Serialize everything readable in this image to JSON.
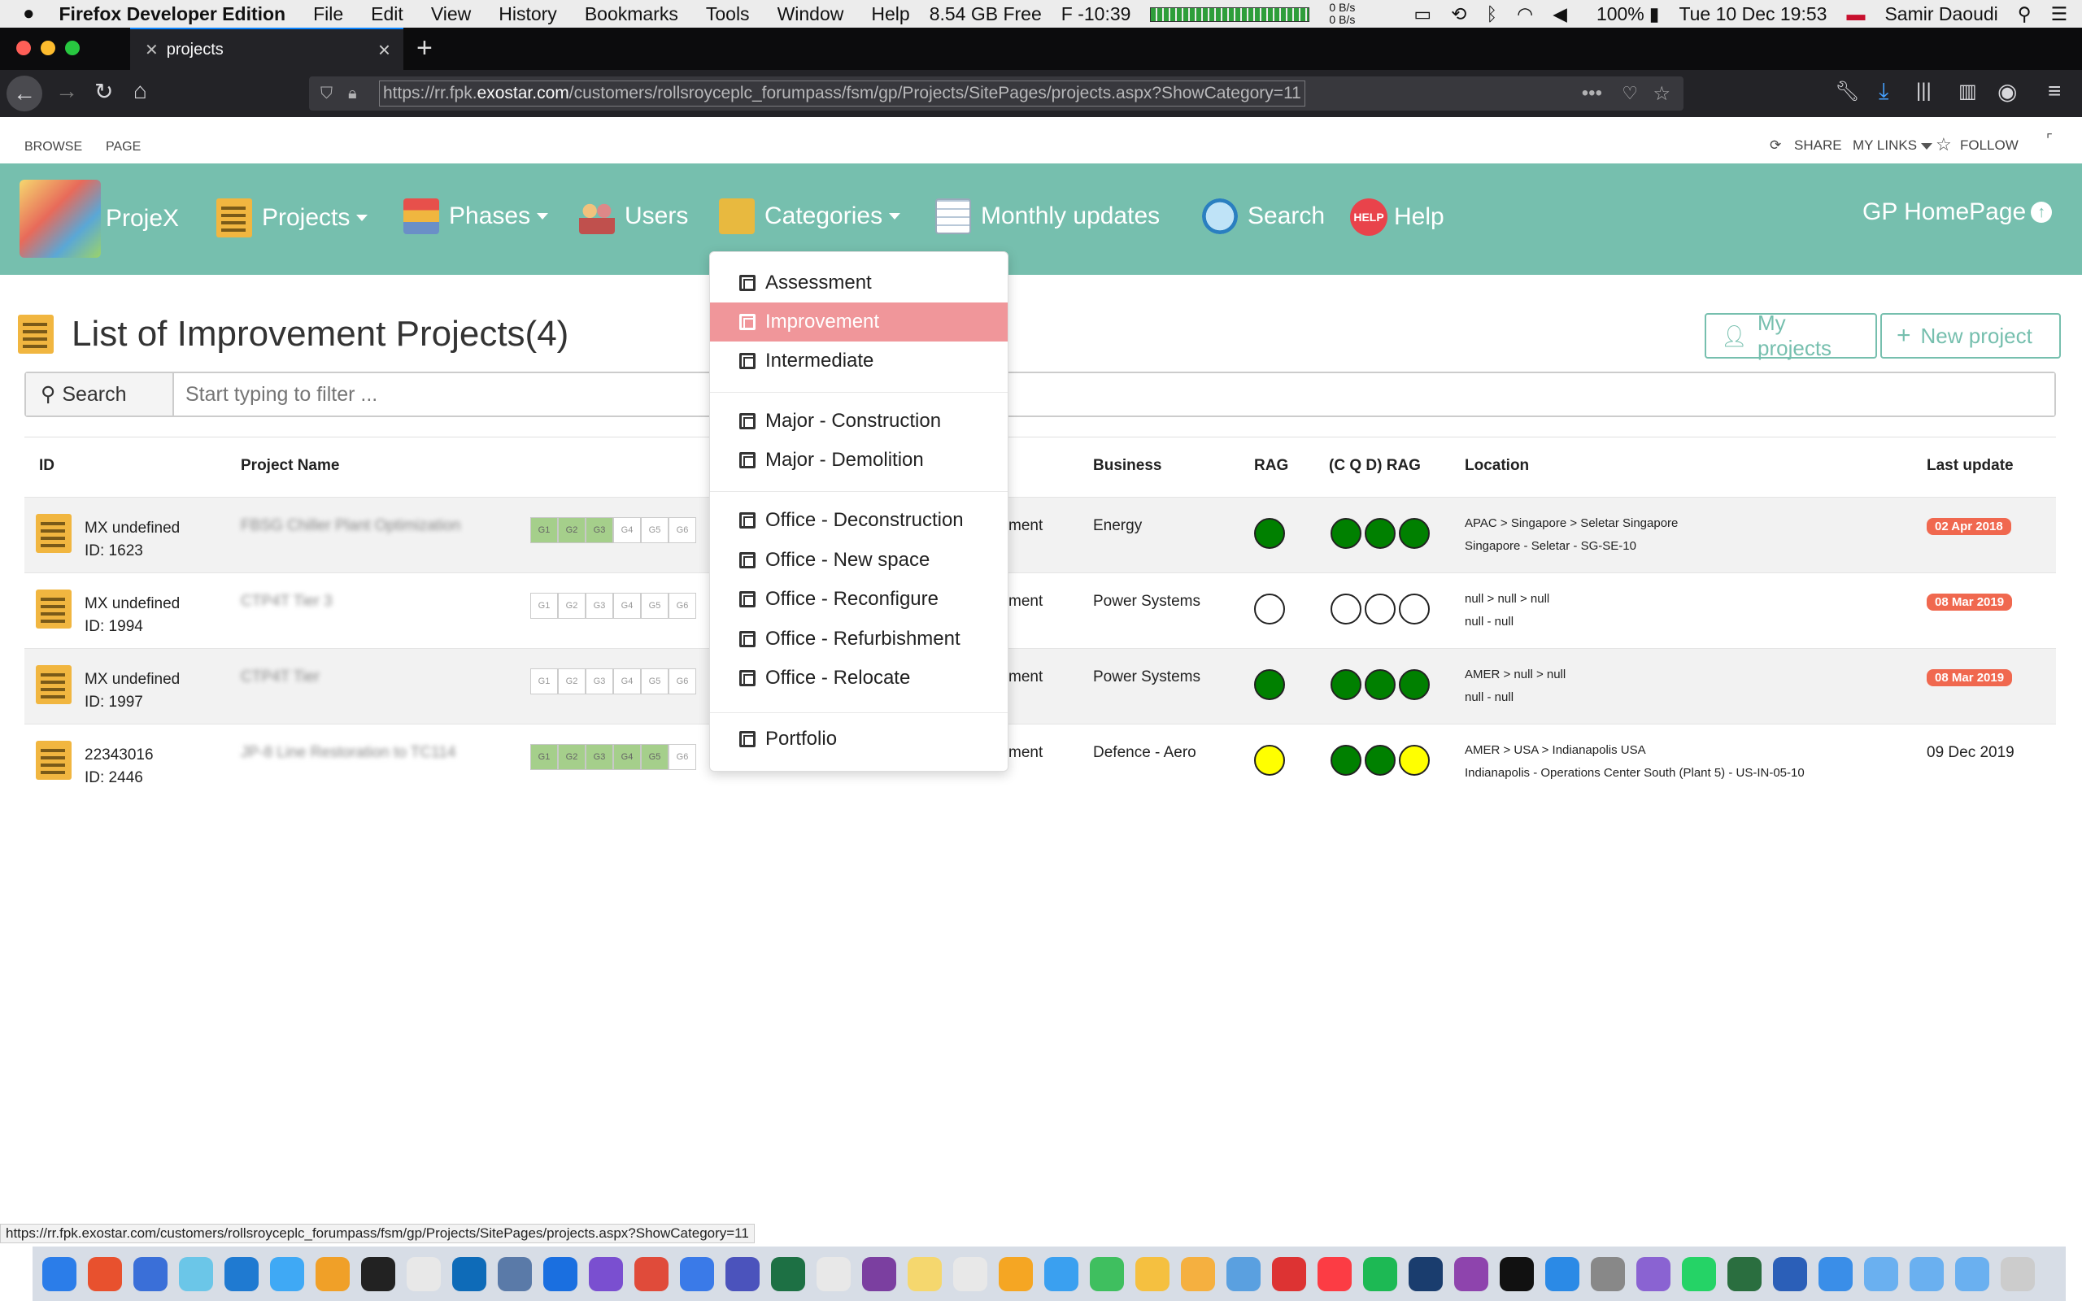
{
  "macbar": {
    "apple": "",
    "app": "Firefox Developer Edition",
    "menus": [
      "File",
      "Edit",
      "View",
      "History",
      "Bookmarks",
      "Tools",
      "Window",
      "Help"
    ],
    "mem": "8.54 GB Free",
    "temp": "F -10:39",
    "net_up": "0 B/s",
    "net_down": "0 B/s",
    "battery_pct": "100%",
    "datetime": "Tue 10 Dec  19:53",
    "user": "Samir Daoudi"
  },
  "browser": {
    "tab_title": "projects",
    "url_prefix": "https://rr.fpk.",
    "url_domain": "exostar.com",
    "url_path": "/customers/rollsroyceplc_forumpass/fsm/gp/Projects/SitePages/projects.aspx?ShowCategory=11",
    "status_url": "https://rr.fpk.exostar.com/customers/rollsroyceplc_forumpass/fsm/gp/Projects/SitePages/projects.aspx?ShowCategory=11"
  },
  "ribbon": {
    "browse": "BROWSE",
    "page": "PAGE",
    "share": "SHARE",
    "my_links": "MY LINKS",
    "follow": "FOLLOW"
  },
  "nav": {
    "brand": "ProjeX",
    "projects": "Projects",
    "phases": "Phases",
    "users": "Users",
    "categories": "Categories",
    "monthly": "Monthly updates",
    "search": "Search",
    "help": "Help",
    "help_badge": "HELP",
    "gp_home": "GP HomePage"
  },
  "categories_menu": [
    {
      "label": "Assessment",
      "active": false
    },
    {
      "label": "Improvement",
      "active": true
    },
    {
      "label": "Intermediate",
      "active": false
    },
    {
      "label": "Major - Construction",
      "active": false
    },
    {
      "label": "Major - Demolition",
      "active": false
    },
    {
      "label": "Office - Deconstruction",
      "active": false
    },
    {
      "label": "Office - New space",
      "active": false
    },
    {
      "label": "Office - Reconfigure",
      "active": false
    },
    {
      "label": "Office - Refurbishment",
      "active": false
    },
    {
      "label": "Office - Relocate",
      "active": false
    },
    {
      "label": "Portfolio",
      "active": false
    }
  ],
  "page": {
    "title": "List of Improvement Projects(4)",
    "my_projects": "My projects",
    "new_project": "New project",
    "search_label": "Search",
    "search_placeholder": "Start typing to filter ..."
  },
  "table": {
    "headers": {
      "id": "ID",
      "name": "Project Name",
      "business": "Business",
      "rag": "RAG",
      "cqd": "(C Q D) RAG",
      "location": "Location",
      "last_update": "Last update"
    },
    "gate_labels": [
      "G1",
      "G2",
      "G3",
      "G4",
      "G5",
      "G6"
    ],
    "colors": {
      "green": "#008000",
      "yellow": "#ffff00",
      "empty": "#ffffff",
      "badge": "#f0684f",
      "gate_on": "#a5cf8b"
    },
    "rows": [
      {
        "id_line1": "MX undefined",
        "id_line2": "ID: 1623",
        "name": "FBSG Chiller Plant Optimization",
        "gates_done": 3,
        "category_frag": "ment",
        "business": "Energy",
        "rag": "green",
        "cqd": [
          "green",
          "green",
          "green"
        ],
        "loc1": "APAC > Singapore > Seletar Singapore",
        "loc2": "Singapore - Seletar - SG-SE-10",
        "update": "02 Apr 2018",
        "badge": true
      },
      {
        "id_line1": "MX undefined",
        "id_line2": "ID: 1994",
        "name": "CTP4T Tier 3",
        "gates_done": 0,
        "category_frag": "ment",
        "business": "Power Systems",
        "rag": "empty",
        "cqd": [
          "empty",
          "empty",
          "empty"
        ],
        "loc1": "null > null > null",
        "loc2": "null - null",
        "update": "08 Mar 2019",
        "badge": true
      },
      {
        "id_line1": "MX undefined",
        "id_line2": "ID: 1997",
        "name": "CTP4T Tier",
        "gates_done": 0,
        "category_frag": "ment",
        "business": "Power Systems",
        "rag": "green",
        "cqd": [
          "green",
          "green",
          "green"
        ],
        "loc1": "AMER > null > null",
        "loc2": "null - null",
        "update": "08 Mar 2019",
        "badge": true
      },
      {
        "id_line1": "22343016",
        "id_line2": "ID: 2446",
        "name": "JP-8 Line Restoration to TC114",
        "gates_done": 5,
        "category_frag": "ment",
        "business": "Defence - Aero",
        "rag": "yellow",
        "cqd": [
          "green",
          "green",
          "yellow"
        ],
        "loc1": "AMER > USA > Indianapolis USA",
        "loc2": "Indianapolis - Operations Center South (Plant 5) - US-IN-05-10",
        "update": "09 Dec 2019",
        "badge": false
      }
    ]
  }
}
